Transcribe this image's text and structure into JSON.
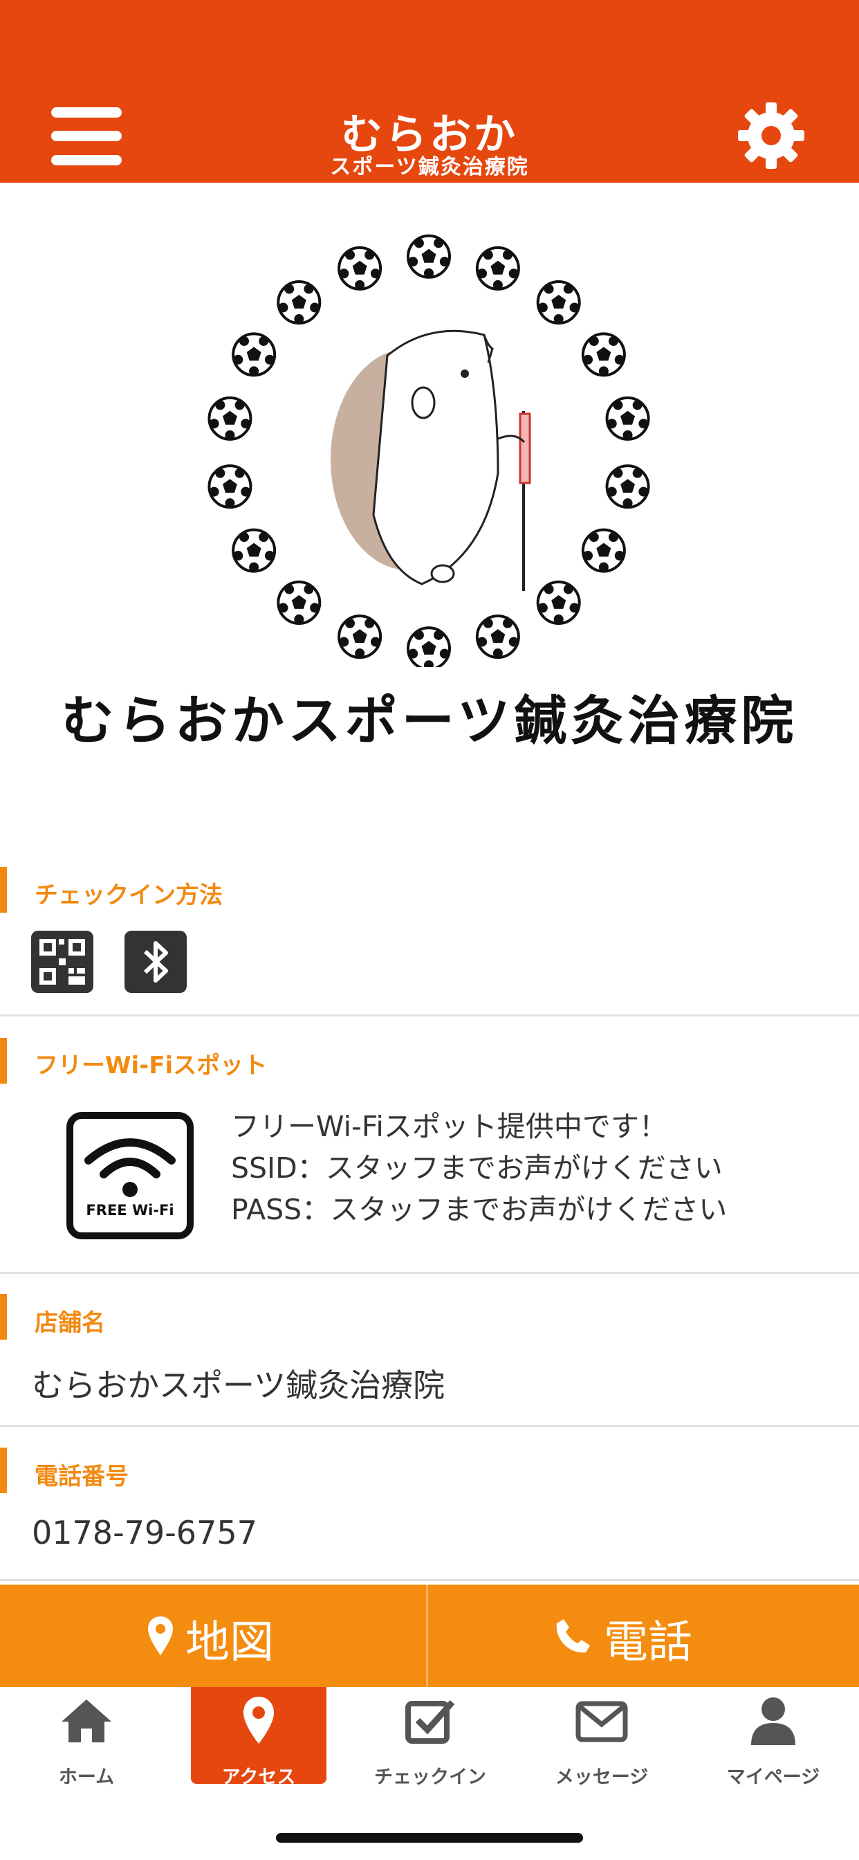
{
  "header": {
    "title_line1": "むらおか",
    "title_line2": "スポーツ鍼灸治療院",
    "menu_icon": "hamburger-menu-icon",
    "settings_icon": "gear-icon",
    "accent_color": "#e6470f"
  },
  "hero": {
    "clinic_logo_text": "むらおかスポーツ鍼灸治療院",
    "image": "hedgehog-with-soccer-balls-illustration"
  },
  "checkin": {
    "title": "チェックイン方法",
    "methods": [
      "qr-code-icon",
      "bluetooth-icon"
    ]
  },
  "wifi": {
    "title": "フリーWi-Fiスポット",
    "badge_text": "FREE Wi-Fi",
    "line1": "フリーWi-Fiスポット提供中です！",
    "line2": "SSID：スタッフまでお声がけください",
    "line3": "PASS：スタッフまでお声がけください"
  },
  "store": {
    "title": "店舗名",
    "value": "むらおかスポーツ鍼灸治療院"
  },
  "phone": {
    "title": "電話番号",
    "value": "0178-79-6757"
  },
  "actions": {
    "map_label": "地図",
    "call_label": "電話",
    "color": "#f48c0f"
  },
  "tabbar": {
    "items": [
      {
        "label": "ホーム",
        "icon": "home-icon"
      },
      {
        "label": "アクセス",
        "icon": "map-pin-icon",
        "active": true
      },
      {
        "label": "チェックイン",
        "icon": "checkbox-icon"
      },
      {
        "label": "メッセージ",
        "icon": "envelope-icon"
      },
      {
        "label": "マイページ",
        "icon": "person-icon"
      }
    ]
  }
}
